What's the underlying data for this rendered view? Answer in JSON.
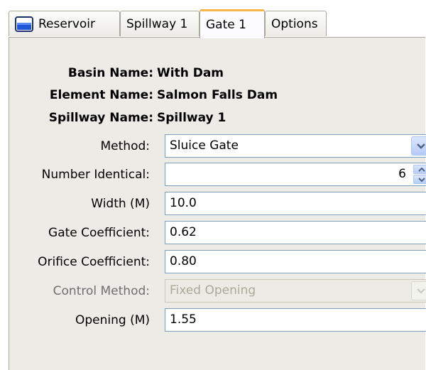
{
  "tabs": [
    {
      "label": "Reservoir",
      "icon": "reservoir-icon",
      "active": false
    },
    {
      "label": "Spillway 1",
      "active": false
    },
    {
      "label": "Gate 1",
      "active": true
    },
    {
      "label": "Options",
      "active": false
    }
  ],
  "info": {
    "basin_label": "Basin Name:",
    "basin_value": "With Dam",
    "element_label": "Element Name:",
    "element_value": "Salmon Falls Dam",
    "spillway_label": "Spillway Name:",
    "spillway_value": "Spillway 1"
  },
  "form": {
    "method": {
      "label": "Method:",
      "value": "Sluice Gate"
    },
    "number_identical": {
      "label": "Number Identical:",
      "value": "6"
    },
    "width": {
      "label": "Width (M)",
      "value": "10.0"
    },
    "gate_coefficient": {
      "label": "Gate Coefficient:",
      "value": "0.62"
    },
    "orifice_coefficient": {
      "label": "Orifice Coefficient:",
      "value": "0.80"
    },
    "control_method": {
      "label": "Control Method:",
      "value": "Fixed Opening",
      "disabled": true
    },
    "opening": {
      "label": "Opening (M)",
      "value": "1.55"
    }
  },
  "colors": {
    "panel_bg": "#ECEBE6",
    "active_tab_accent": "#F5B647",
    "field_border": "#7F9DB9",
    "disabled_text": "#ACA899"
  }
}
